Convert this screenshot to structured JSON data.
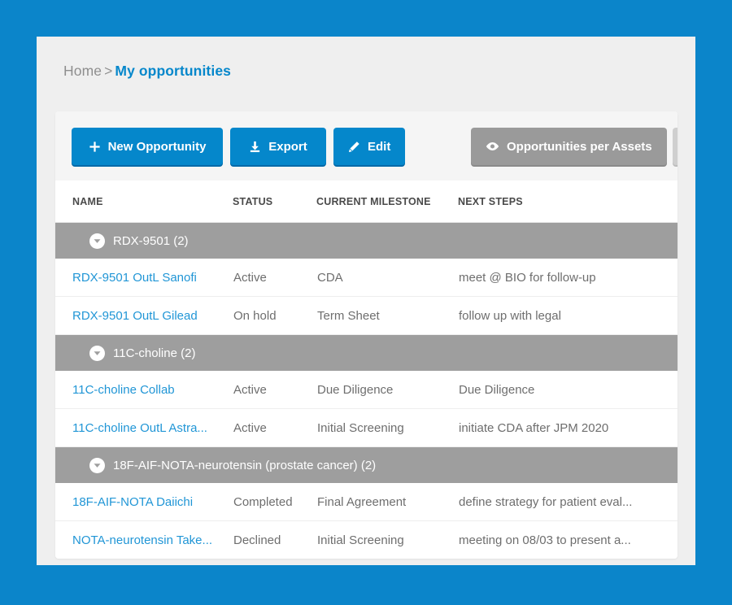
{
  "breadcrumb": {
    "home": "Home",
    "separator": ">",
    "current": "My opportunities"
  },
  "toolbar": {
    "new_opportunity_label": "New Opportunity",
    "export_label": "Export",
    "edit_label": "Edit",
    "opportunities_per_assets_label": "Opportunities per Assets",
    "settings_label": ""
  },
  "table": {
    "columns": [
      {
        "key": "name",
        "label": "NAME"
      },
      {
        "key": "status",
        "label": "STATUS"
      },
      {
        "key": "milestone",
        "label": "CURRENT MILESTONE"
      },
      {
        "key": "next_steps",
        "label": "NEXT STEPS"
      }
    ],
    "groups": [
      {
        "title": "RDX-9501 (2)",
        "rows": [
          {
            "name": "RDX-9501 OutL Sanofi",
            "status": "Active",
            "milestone": "CDA",
            "next_steps": "meet @ BIO for follow-up"
          },
          {
            "name": "RDX-9501 OutL Gilead",
            "status": "On hold",
            "milestone": "Term Sheet",
            "next_steps": "follow up with legal"
          }
        ]
      },
      {
        "title": "11C-choline (2)",
        "rows": [
          {
            "name": "11C-choline Collab",
            "status": "Active",
            "milestone": "Due Diligence",
            "next_steps": "Due Diligence"
          },
          {
            "name": "11C-choline OutL Astra...",
            "status": "Active",
            "milestone": "Initial Screening",
            "next_steps": "initiate CDA after JPM 2020"
          }
        ]
      },
      {
        "title": "18F-AIF-NOTA-neurotensin (prostate cancer) (2)",
        "rows": [
          {
            "name": "18F-AIF-NOTA Daiichi",
            "status": "Completed",
            "milestone": "Final Agreement",
            "next_steps": "define strategy for patient eval..."
          },
          {
            "name": "NOTA-neurotensin Take...",
            "status": "Declined",
            "milestone": "Initial Screening",
            "next_steps": "meeting on 08/03 to present a..."
          }
        ]
      }
    ]
  },
  "icons": {
    "plus": "plus-icon",
    "download": "download-icon",
    "pencil": "pencil-icon",
    "eye": "eye-icon",
    "gear": "gear-icon",
    "chevron_down": "chevron-down-icon"
  },
  "colors": {
    "frame": "#0b85ca",
    "page": "#efefef",
    "primary_button": "#0587cb",
    "toggle_button": "#9a9a9a",
    "gear_button": "#cfcfcf",
    "group_header": "#9e9e9e",
    "link": "#2196d6",
    "text": "#6e6e6e"
  }
}
